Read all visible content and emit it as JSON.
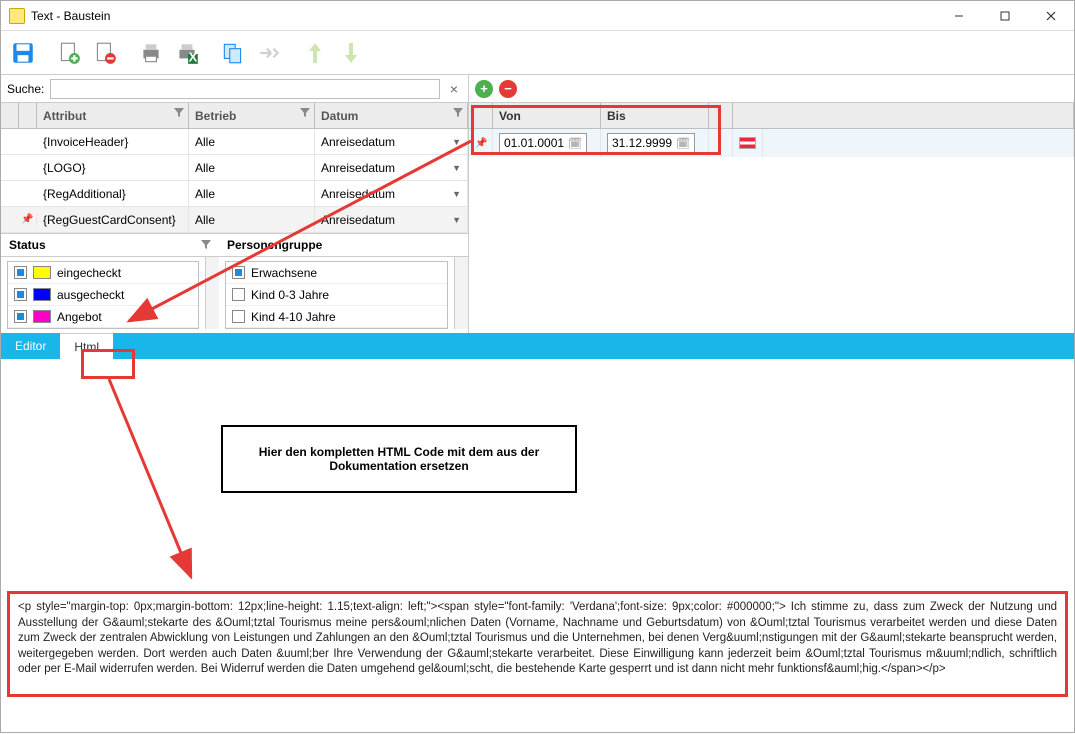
{
  "window": {
    "title": "Text - Baustein"
  },
  "search": {
    "label": "Suche:",
    "value": ""
  },
  "attr_grid": {
    "headers": {
      "attribut": "Attribut",
      "betrieb": "Betrieb",
      "datum": "Datum"
    },
    "rows": [
      {
        "attribut": "{InvoiceHeader}",
        "betrieb": "Alle",
        "datum": "Anreisedatum",
        "pinned": false
      },
      {
        "attribut": "{LOGO}",
        "betrieb": "Alle",
        "datum": "Anreisedatum",
        "pinned": false
      },
      {
        "attribut": "{RegAdditional}",
        "betrieb": "Alle",
        "datum": "Anreisedatum",
        "pinned": false
      },
      {
        "attribut": "{RegGuestCardConsent}",
        "betrieb": "Alle",
        "datum": "Anreisedatum",
        "pinned": true
      }
    ]
  },
  "status": {
    "header": "Status",
    "items": [
      {
        "label": "eingecheckt",
        "checked": true,
        "color": "#ffff00"
      },
      {
        "label": "ausgecheckt",
        "checked": true,
        "color": "#0000ff"
      },
      {
        "label": "Angebot",
        "checked": true,
        "color": "#ff00c8"
      }
    ]
  },
  "persgruppe": {
    "header": "Personengruppe",
    "items": [
      {
        "label": "Erwachsene",
        "checked": true
      },
      {
        "label": "Kind 0-3 Jahre",
        "checked": false
      },
      {
        "label": "Kind 4-10 Jahre",
        "checked": false
      }
    ]
  },
  "date_grid": {
    "headers": {
      "von": "Von",
      "bis": "Bis"
    },
    "row": {
      "von": "01.01.0001",
      "bis": "31.12.9999"
    }
  },
  "tabs": {
    "editor": "Editor",
    "html": "Html"
  },
  "info_box": "Hier den kompletten HTML Code mit dem aus der Dokumentation ersetzen",
  "html_code": "<p style=\"margin-top: 0px;margin-bottom: 12px;line-height: 1.15;text-align: left;\"><span style=\"font-family: 'Verdana';font-size: 9px;color: #000000;\"> Ich stimme zu, dass zum Zweck der Nutzung und Ausstellung der G&auml;stekarte des &Ouml;tztal Tourismus meine pers&ouml;nlichen Daten (Vorname, Nachname und Geburtsdatum) von &Ouml;tztal Tourismus verarbeitet werden und diese Daten zum Zweck der zentralen Abwicklung von Leistungen und Zahlungen an den &Ouml;tztal Tourismus und die Unternehmen, bei denen Verg&uuml;nstigungen mit der G&auml;stekarte beansprucht werden, weitergegeben werden. Dort werden auch Daten &uuml;ber Ihre Verwendung der G&auml;stekarte verarbeitet. Diese Einwilligung kann jederzeit beim &Ouml;tztal Tourismus m&uuml;ndlich, schriftlich oder per E-Mail widerrufen werden. Bei Widerruf werden die Daten umgehend gel&ouml;scht, die bestehende Karte gesperrt und ist dann nicht mehr funktionsf&auml;hig.</span></p>"
}
